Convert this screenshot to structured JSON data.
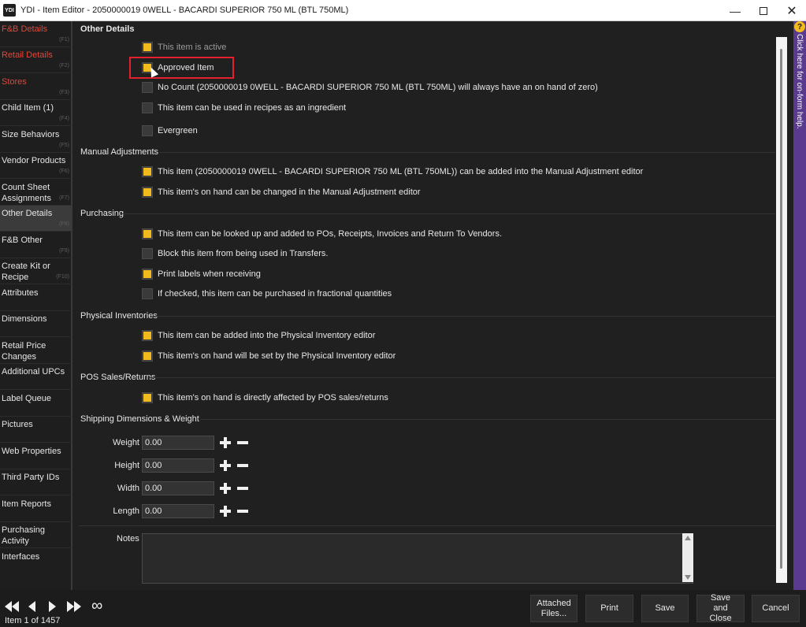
{
  "window": {
    "icon_text": "YDI",
    "title": "YDI - Item Editor - 2050000019 0WELL - BACARDI SUPERIOR 750 ML (BTL 750ML)",
    "minimize": "—",
    "close": "✕"
  },
  "sidebar": {
    "items": [
      {
        "label": "F&B Details",
        "key": "(F1)"
      },
      {
        "label": "Retail Details",
        "key": "(F2)"
      },
      {
        "label": "Stores",
        "key": "(F3)"
      },
      {
        "label": "Child Item (1)",
        "key": "(F4)"
      },
      {
        "label": "Size Behaviors",
        "key": "(F5)"
      },
      {
        "label": "Vendor Products",
        "key": "(F6)"
      },
      {
        "label": "Count Sheet Assignments",
        "key": "(F7)"
      },
      {
        "label": "Other Details",
        "key": "(F8)"
      },
      {
        "label": "F&B Other",
        "key": "(F9)"
      },
      {
        "label": "Create Kit or Recipe",
        "key": "(F10)"
      },
      {
        "label": "Attributes",
        "key": ""
      },
      {
        "label": "Dimensions",
        "key": ""
      },
      {
        "label": "Retail Price Changes",
        "key": ""
      },
      {
        "label": "Additional UPCs",
        "key": ""
      },
      {
        "label": "Label Queue",
        "key": ""
      },
      {
        "label": "Pictures",
        "key": ""
      },
      {
        "label": "Web Properties",
        "key": ""
      },
      {
        "label": "Third Party IDs",
        "key": ""
      },
      {
        "label": "Item Reports",
        "key": ""
      },
      {
        "label": "Purchasing Activity",
        "key": ""
      },
      {
        "label": "Interfaces",
        "key": ""
      }
    ]
  },
  "sections": {
    "other_details": "Other Details",
    "manual_adjustments": "Manual Adjustments",
    "purchasing": "Purchasing",
    "physical_inventories": "Physical Inventories",
    "pos_sales_returns": "POS Sales/Returns",
    "shipping": "Shipping Dimensions & Weight"
  },
  "checkboxes": {
    "active": {
      "label": "This item is active",
      "checked": true
    },
    "approved": {
      "label": "Approved Item",
      "checked": true
    },
    "no_count": {
      "label": "No Count (2050000019 0WELL - BACARDI SUPERIOR 750 ML (BTL 750ML) will always have an on hand of zero)",
      "checked": false
    },
    "recipes": {
      "label": "This item can be used in recipes as an ingredient",
      "checked": false
    },
    "evergreen": {
      "label": "Evergreen",
      "checked": false
    },
    "manual_add": {
      "label": "This item (2050000019 0WELL - BACARDI SUPERIOR 750 ML (BTL 750ML)) can be added into the Manual Adjustment editor",
      "checked": true
    },
    "manual_change": {
      "label": "This item's on hand can be changed in the Manual Adjustment editor",
      "checked": true
    },
    "lookup_pos": {
      "label": "This item can be looked up and added to POs, Receipts, Invoices and Return To Vendors.",
      "checked": true
    },
    "block_transfers": {
      "label": "Block this item from being used in Transfers.",
      "checked": false
    },
    "print_labels": {
      "label": "Print labels when receiving",
      "checked": true
    },
    "fractional": {
      "label": "If checked, this item can be purchased in fractional quantities",
      "checked": false
    },
    "phys_add": {
      "label": "This item can be added into the Physical Inventory editor",
      "checked": true
    },
    "phys_set": {
      "label": "This item's on hand will be set by the Physical Inventory editor",
      "checked": true
    },
    "pos_affect": {
      "label": "This item's on hand is directly affected by POS sales/returns",
      "checked": true
    }
  },
  "shipping": {
    "weight": {
      "label": "Weight",
      "value": "0.00"
    },
    "height": {
      "label": "Height",
      "value": "0.00"
    },
    "width": {
      "label": "Width",
      "value": "0.00"
    },
    "length": {
      "label": "Length",
      "value": "0.00"
    }
  },
  "notes": {
    "label": "Notes",
    "value": ""
  },
  "help": {
    "text": "Click here for on-form help.",
    "icon": "?"
  },
  "footer": {
    "item_count": "Item 1 of 1457",
    "infinity": "∞",
    "buttons": {
      "attached": "Attached Files...",
      "print": "Print",
      "save": "Save",
      "save_close": "Save and Close",
      "cancel": "Cancel"
    }
  },
  "colors": {
    "accent_checkbox": "#f1bb1e",
    "nav_red": "#e0483a",
    "highlight_box": "#e5202e",
    "help_strip": "#5a3a8e"
  }
}
